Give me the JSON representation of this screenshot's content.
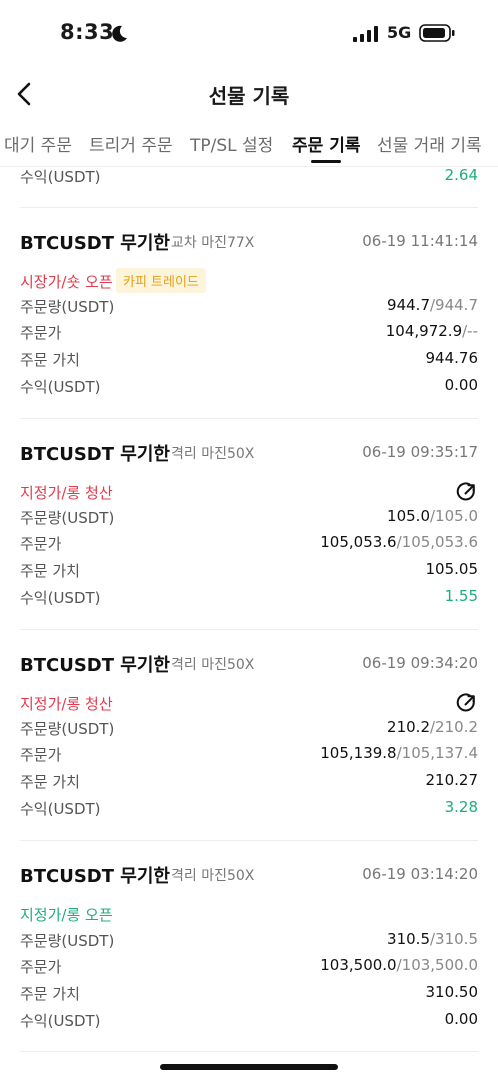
{
  "status_bar": {
    "time": "8:33",
    "network": "5G"
  },
  "header": {
    "title": "선물 기록"
  },
  "tabs": [
    {
      "label": "대기 주문",
      "active": false
    },
    {
      "label": "트리거 주문",
      "active": false
    },
    {
      "label": "TP/SL 설정",
      "active": false
    },
    {
      "label": "주문 기록",
      "active": true
    },
    {
      "label": "선물 거래 기록",
      "active": false
    }
  ],
  "top_partial": {
    "label": "수익(USDT)",
    "value": "2.64"
  },
  "orders": [
    {
      "pair": "BTCUSDT 무기한",
      "mode": "교차 마진77X",
      "time": "06-19 11:41:14",
      "type": "시장가/숏 오픈",
      "badge": "카피 트레이드",
      "qty_label": "주문량(USDT)",
      "qty_filled": "944.7",
      "qty_total": "/944.7",
      "price_label": "주문가",
      "price_main": "104,972.9",
      "price_sub": "/--",
      "value_label": "주문 가치",
      "value": "944.76",
      "pnl_label": "수익(USDT)",
      "pnl": "0.00"
    },
    {
      "pair": "BTCUSDT 무기한",
      "mode": "격리 마진50X",
      "time": "06-19 09:35:17",
      "type": "지정가/롱 청산",
      "badge": "",
      "qty_label": "주문량(USDT)",
      "qty_filled": "105.0",
      "qty_total": "/105.0",
      "price_label": "주문가",
      "price_main": "105,053.6",
      "price_sub": "/105,053.6",
      "value_label": "주문 가치",
      "value": "105.05",
      "pnl_label": "수익(USDT)",
      "pnl": "1.55"
    },
    {
      "pair": "BTCUSDT 무기한",
      "mode": "격리 마진50X",
      "time": "06-19 09:34:20",
      "type": "지정가/롱 청산",
      "badge": "",
      "qty_label": "주문량(USDT)",
      "qty_filled": "210.2",
      "qty_total": "/210.2",
      "price_label": "주문가",
      "price_main": "105,139.8",
      "price_sub": "/105,137.4",
      "value_label": "주문 가치",
      "value": "210.27",
      "pnl_label": "수익(USDT)",
      "pnl": "3.28"
    },
    {
      "pair": "BTCUSDT 무기한",
      "mode": "격리 마진50X",
      "time": "06-19 03:14:20",
      "type": "지정가/롱 오픈",
      "badge": "",
      "qty_label": "주문량(USDT)",
      "qty_filled": "310.5",
      "qty_total": "/310.5",
      "price_label": "주문가",
      "price_main": "103,500.0",
      "price_sub": "/103,500.0",
      "value_label": "주문 가치",
      "value": "310.50",
      "pnl_label": "수익(USDT)",
      "pnl": "0.00"
    }
  ],
  "colors": {
    "green": "#1eae7a",
    "red": "#e23b4e",
    "badge_bg": "#fdf4dc",
    "badge_text": "#e0a21a"
  }
}
